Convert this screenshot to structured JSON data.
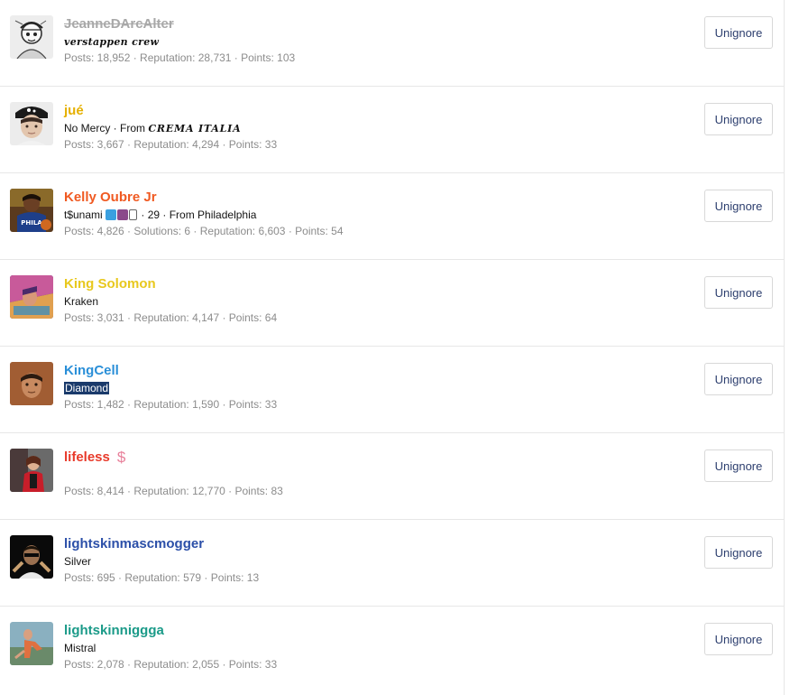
{
  "ignored_users": [
    {
      "username": "JeanneDArcAlter",
      "username_color": "#a8a8a8",
      "strike": true,
      "title_parts": [
        {
          "type": "gothic",
          "text": "verstappen crew"
        }
      ],
      "stats": "Posts: 18,952 · Reputation: 28,731 · Points: 103",
      "button": "Unignore",
      "avatar": "sketch"
    },
    {
      "username": "jué",
      "username_color": "#e5b000",
      "strike": false,
      "title_parts": [
        {
          "type": "plain",
          "text": "No Mercy · From "
        },
        {
          "type": "crema",
          "text": "CREMA ITALIA"
        }
      ],
      "stats": "Posts: 3,667 · Reputation: 4,294 · Points: 33",
      "button": "Unignore",
      "avatar": "boy-cap"
    },
    {
      "username": "Kelly Oubre Jr",
      "username_color": "#f05a22",
      "strike": false,
      "title_parts": [
        {
          "type": "plain",
          "text": "t$unami "
        },
        {
          "type": "emoji",
          "text": ""
        },
        {
          "type": "plain",
          "text": " · 29 · From Philadelphia"
        }
      ],
      "stats": "Posts: 4,826 · Solutions: 6 · Reputation: 6,603 · Points: 54",
      "button": "Unignore",
      "avatar": "basketball"
    },
    {
      "username": "King Solomon",
      "username_color": "#e8c81e",
      "strike": false,
      "title_parts": [
        {
          "type": "plain",
          "text": "Kraken"
        }
      ],
      "stats": "Posts: 3,031 · Reputation: 4,147 · Points: 64",
      "button": "Unignore",
      "avatar": "colorful"
    },
    {
      "username": "KingCell",
      "username_color": "#2a8fd8",
      "strike": false,
      "title_parts": [
        {
          "type": "highlight",
          "text": "Diamond"
        }
      ],
      "stats": "Posts: 1,482 · Reputation: 1,590 · Points: 33",
      "button": "Unignore",
      "avatar": "face-warm"
    },
    {
      "username": "lifeless",
      "username_color": "#e83a2a",
      "strike": false,
      "title_parts": [],
      "stats": "Posts: 8,414 · Reputation: 12,770 · Points: 83",
      "button": "Unignore",
      "avatar": "red-figure"
    },
    {
      "username": "lightskinmascmogger",
      "username_color": "#2b4fa8",
      "strike": false,
      "title_parts": [
        {
          "type": "plain",
          "text": "Silver"
        }
      ],
      "stats": "Posts: 695 · Reputation: 579 · Points: 13",
      "button": "Unignore",
      "avatar": "dark"
    },
    {
      "username": "lightskinniggga",
      "username_color": "#1a9a88",
      "strike": false,
      "title_parts": [
        {
          "type": "plain",
          "text": "Mistral"
        }
      ],
      "stats": "Posts: 2,078 · Reputation: 2,055 · Points: 33",
      "button": "Unignore",
      "avatar": "outdoor"
    }
  ],
  "lifeless_badge_glyph": "$"
}
